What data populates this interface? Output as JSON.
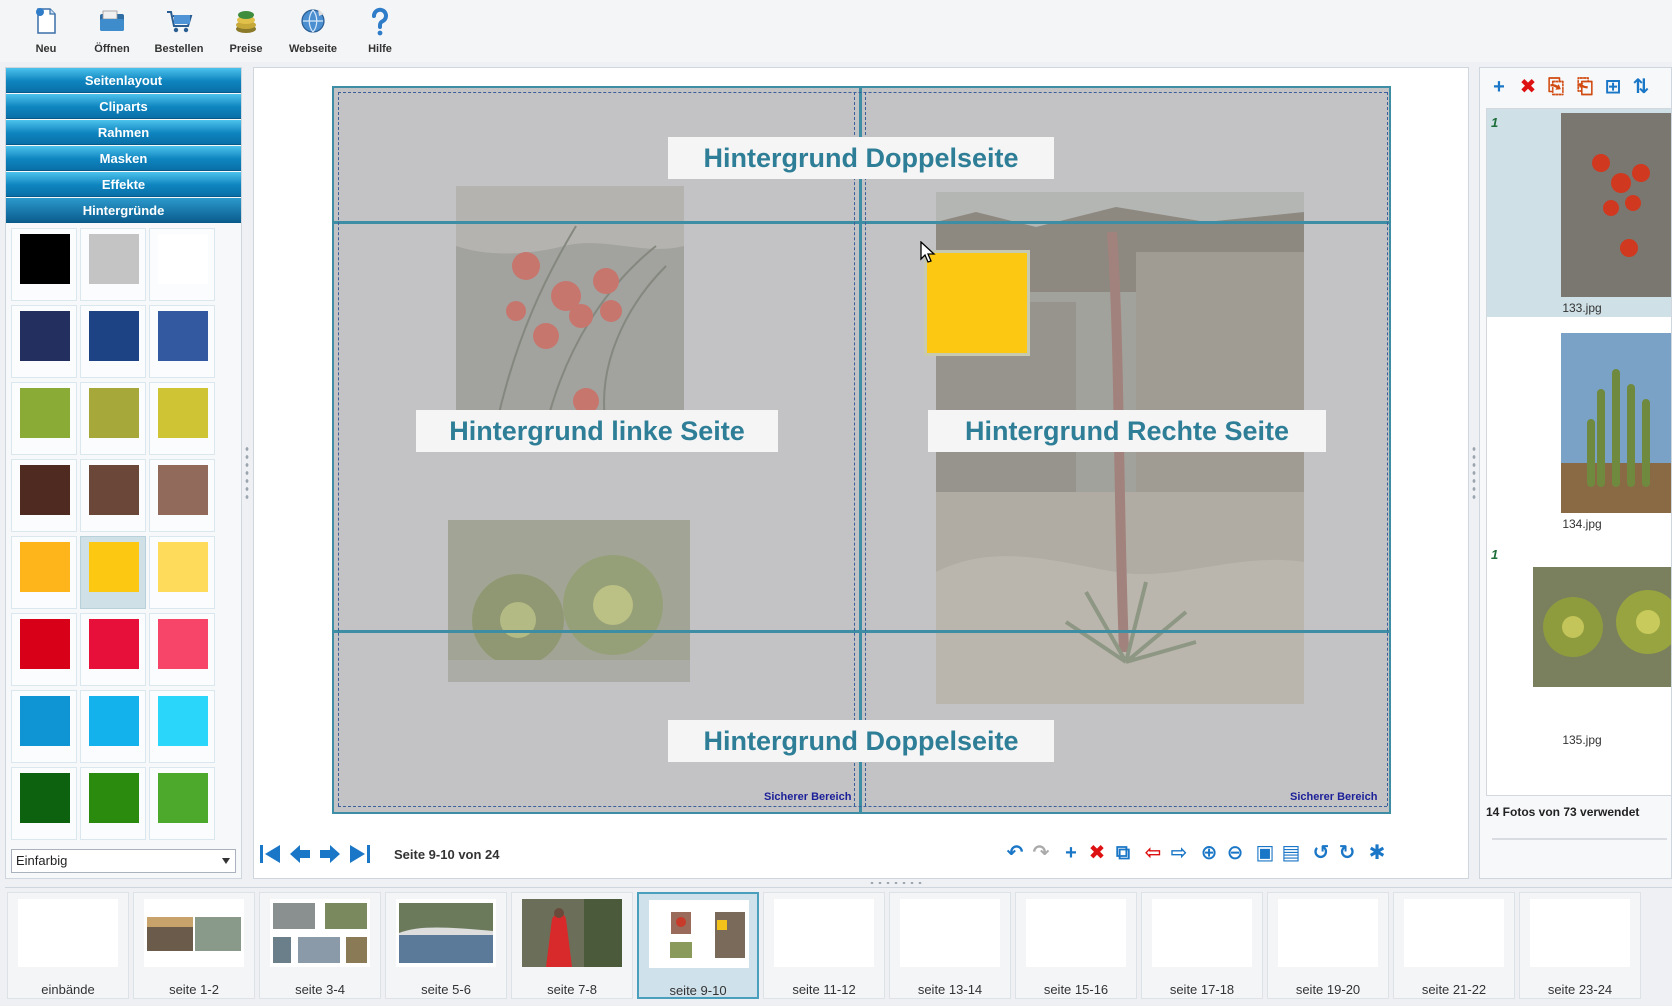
{
  "toolbar": {
    "items": [
      {
        "label": "Neu",
        "icon": "new-document-icon"
      },
      {
        "label": "Öffnen",
        "icon": "open-folder-icon"
      },
      {
        "label": "Bestellen",
        "icon": "shopping-cart-icon"
      },
      {
        "label": "Preise",
        "icon": "coins-icon"
      },
      {
        "label": "Webseite",
        "icon": "globe-icon"
      },
      {
        "label": "Hilfe",
        "icon": "help-icon"
      }
    ]
  },
  "left_panel": {
    "sections": [
      {
        "label": "Seitenlayout"
      },
      {
        "label": "Cliparts"
      },
      {
        "label": "Rahmen"
      },
      {
        "label": "Masken"
      },
      {
        "label": "Effekte"
      },
      {
        "label": "Hintergründe",
        "active": true
      }
    ],
    "swatches": [
      "#000000",
      "#c4c4c4",
      "#ffffff",
      "#23305f",
      "#1d4385",
      "#335aa1",
      "#8aab35",
      "#a6a83a",
      "#cfc534",
      "#4f2a21",
      "#6a4738",
      "#926a5b",
      "#fdb51b",
      "#fcc812",
      "#fedb5b",
      "#d80018",
      "#e7103b",
      "#f64569",
      "#0f95d3",
      "#13b2ec",
      "#2ad6f9",
      "#0c620e",
      "#2b8b0f",
      "#4da92c"
    ],
    "selected_swatch": 13,
    "background_mode": "Einfarbig"
  },
  "spread": {
    "label_top": "Hintergrund Doppelseite",
    "label_left": "Hintergrund linke Seite",
    "label_right": "Hintergrund Rechte Seite",
    "label_bottom": "Hintergrund Doppelseite",
    "safe_area_left": "Sicherer Bereich",
    "safe_area_right": "Sicherer Bereich",
    "selected_block_color": "#fcc812"
  },
  "nav": {
    "page_indicator": "Seite 9-10 von 24"
  },
  "right_panel": {
    "photos": [
      {
        "file": "133.jpg",
        "count": "1",
        "selected": true
      },
      {
        "file": "134.jpg",
        "count": ""
      },
      {
        "file": "135.jpg",
        "count": "1"
      }
    ],
    "fotos_used": "14 Fotos von 73 verwendet"
  },
  "pages": [
    {
      "label": "einbände"
    },
    {
      "label": "seite 1-2"
    },
    {
      "label": "seite 3-4"
    },
    {
      "label": "seite 5-6"
    },
    {
      "label": "seite 7-8"
    },
    {
      "label": "seite 9-10",
      "active": true
    },
    {
      "label": "seite 11-12"
    },
    {
      "label": "seite 13-14"
    },
    {
      "label": "seite 15-16"
    },
    {
      "label": "seite 17-18"
    },
    {
      "label": "seite 19-20"
    },
    {
      "label": "seite 21-22"
    },
    {
      "label": "seite 23-24"
    }
  ],
  "colors": {
    "accent": "#0e84bf",
    "frame": "#3d8ea5",
    "label_text": "#2d7e96"
  }
}
